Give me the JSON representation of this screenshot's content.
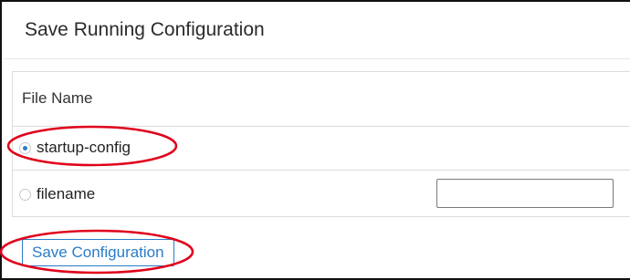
{
  "panel": {
    "title": "Save Running Configuration"
  },
  "table": {
    "header": "File Name",
    "options": [
      {
        "label": "startup-config",
        "selected": true
      },
      {
        "label": "filename",
        "selected": false
      }
    ],
    "filename_value": ""
  },
  "actions": {
    "save_label": "Save Configuration"
  },
  "colors": {
    "accent": "#2a7cc7",
    "annotation": "#e0001a"
  }
}
